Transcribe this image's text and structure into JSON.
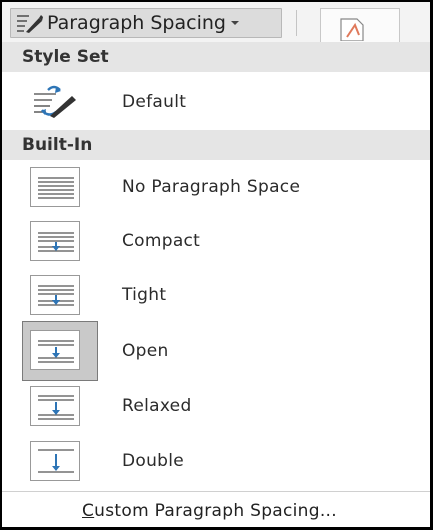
{
  "toolbar": {
    "button_label": "Paragraph Spacing",
    "button_icon": "paragraph-spacing-icon",
    "caret_icon": "dropdown-caret-icon"
  },
  "menu": {
    "style_set_header": "Style Set",
    "default_label": "Default",
    "default_icon": "style-set-default-icon",
    "built_in_header": "Built-In",
    "items": [
      {
        "label": "No Paragraph Space",
        "icon": "no-paragraph-space-icon",
        "selected": false
      },
      {
        "label": "Compact",
        "icon": "compact-spacing-icon",
        "selected": false
      },
      {
        "label": "Tight",
        "icon": "tight-spacing-icon",
        "selected": false
      },
      {
        "label": "Open",
        "icon": "open-spacing-icon",
        "selected": true
      },
      {
        "label": "Relaxed",
        "icon": "relaxed-spacing-icon",
        "selected": false
      },
      {
        "label": "Double",
        "icon": "double-spacing-icon",
        "selected": false
      }
    ],
    "custom_label_first": "C",
    "custom_label_rest": "ustom Paragraph Spacing..."
  },
  "colors": {
    "header_bg": "#e5e5e5",
    "selected_bg": "#c9c9c9",
    "arrow_blue": "#2e75b6"
  }
}
